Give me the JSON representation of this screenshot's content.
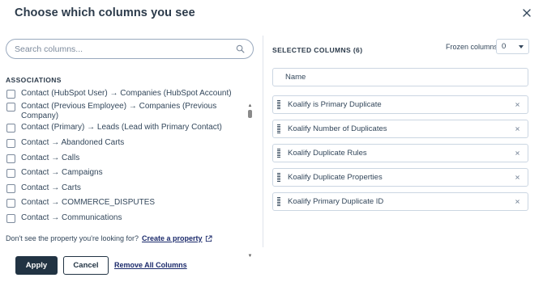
{
  "modal": {
    "title": "Choose which columns you see",
    "close_icon": "close-icon"
  },
  "search": {
    "placeholder": "Search columns...",
    "value": "",
    "icon": "search-icon"
  },
  "associations": {
    "heading": "ASSOCIATIONS",
    "items": [
      {
        "label": "Contact (HubSpot User) → Companies (HubSpot Account)",
        "checked": false
      },
      {
        "label": "Contact (Previous Employee) → Companies (Previous Company)",
        "checked": false
      },
      {
        "label": "Contact (Primary) → Leads (Lead with Primary Contact)",
        "checked": false
      },
      {
        "label": "Contact → Abandoned Carts",
        "checked": false
      },
      {
        "label": "Contact → Calls",
        "checked": false
      },
      {
        "label": "Contact → Campaigns",
        "checked": false
      },
      {
        "label": "Contact → Carts",
        "checked": false
      },
      {
        "label": "Contact → COMMERCE_DISPUTES",
        "checked": false
      },
      {
        "label": "Contact → Communications",
        "checked": false
      }
    ]
  },
  "help": {
    "text": "Don't see the property you're looking for?",
    "link_label": "Create a property",
    "link_icon": "external-link-icon"
  },
  "selected": {
    "heading": "SELECTED COLUMNS (6)",
    "frozen_label": "Frozen columns",
    "frozen_value": "0",
    "fixed_column": "Name",
    "columns": [
      {
        "label": "Koalify is Primary Duplicate"
      },
      {
        "label": "Koalify Number of Duplicates"
      },
      {
        "label": "Koalify Duplicate Rules"
      },
      {
        "label": "Koalify Duplicate Properties"
      },
      {
        "label": "Koalify Primary Duplicate ID"
      }
    ]
  },
  "footer": {
    "apply_label": "Apply",
    "cancel_label": "Cancel",
    "remove_all_label": "Remove All Columns"
  }
}
